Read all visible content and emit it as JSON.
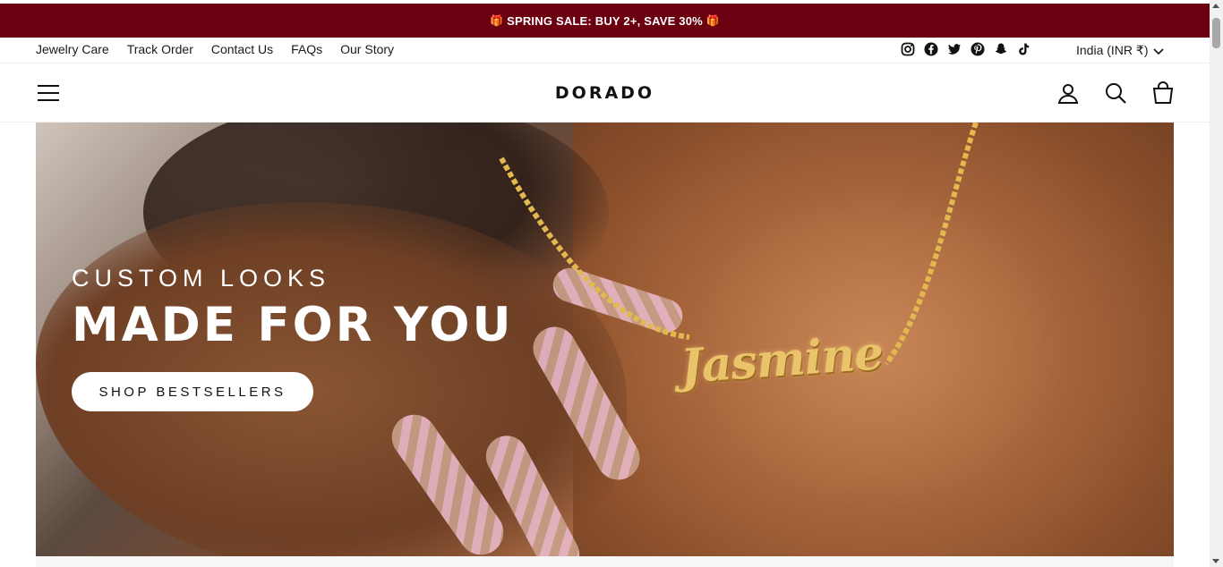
{
  "announcement": {
    "text": "SPRING SALE: BUY 2+, SAVE 30%",
    "icon": "gift-icon",
    "background": "#6b0010"
  },
  "utility_nav": {
    "links": [
      "Jewelry Care",
      "Track Order",
      "Contact Us",
      "FAQs",
      "Our Story"
    ],
    "socials": [
      "instagram-icon",
      "facebook-icon",
      "twitter-icon",
      "pinterest-icon",
      "snapchat-icon",
      "tiktok-icon"
    ],
    "currency": "India (INR ₹)"
  },
  "header": {
    "logo": "DORADO",
    "icons": [
      "menu-icon",
      "account-icon",
      "search-icon",
      "cart-icon"
    ]
  },
  "hero": {
    "eyebrow": "CUSTOM LOOKS",
    "headline": "MADE FOR YOU",
    "cta": "SHOP BESTSELLERS",
    "necklace_name": "Jasmine"
  }
}
